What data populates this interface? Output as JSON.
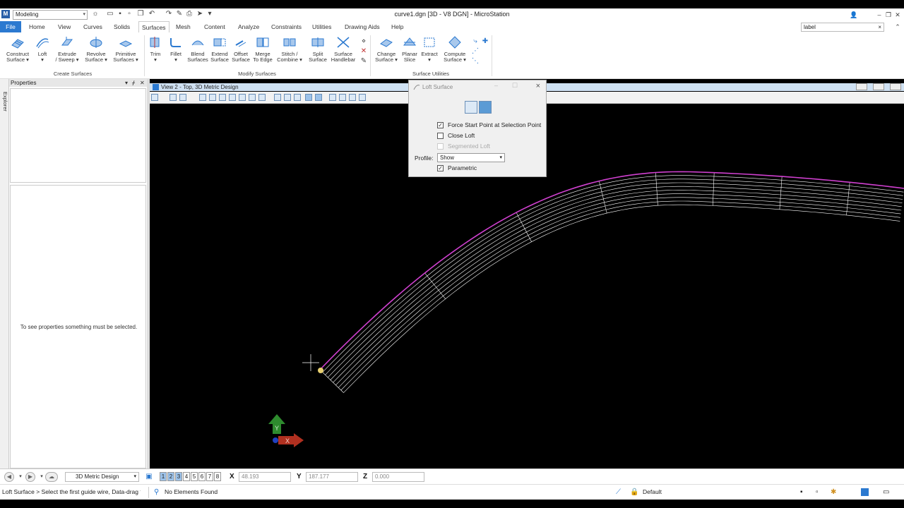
{
  "titlebar": {
    "workflow": "Modeling",
    "title": "curve1.dgn [3D - V8 DGN] - MicroStation",
    "search_value": "label",
    "search_clear": "×"
  },
  "tabs": [
    "File",
    "Home",
    "View",
    "Curves",
    "Solids",
    "Surfaces",
    "Mesh",
    "Content",
    "Analyze",
    "Constraints",
    "Utilities",
    "Drawing Aids",
    "Help"
  ],
  "ribbon": {
    "create": {
      "label": "Create Surfaces",
      "buttons": [
        {
          "l1": "Construct",
          "l2": "Surface ▾"
        },
        {
          "l1": "Loft",
          "l2": "▾"
        },
        {
          "l1": "Extrude",
          "l2": "/ Sweep ▾"
        },
        {
          "l1": "Revolve",
          "l2": "Surface ▾"
        },
        {
          "l1": "Primitive",
          "l2": "Surfaces ▾"
        }
      ]
    },
    "modify": {
      "label": "Modify Surfaces",
      "buttons": [
        {
          "l1": "Trim",
          "l2": "▾"
        },
        {
          "l1": "Fillet",
          "l2": "▾"
        },
        {
          "l1": "Blend",
          "l2": "Surfaces"
        },
        {
          "l1": "Extend",
          "l2": "Surface"
        },
        {
          "l1": "Offset",
          "l2": "Surface"
        },
        {
          "l1": "Merge",
          "l2": "To Edge"
        },
        {
          "l1": "Stitch /",
          "l2": "Combine ▾"
        },
        {
          "l1": "Split",
          "l2": "Surface"
        },
        {
          "l1": "Surface",
          "l2": "Handlebar"
        }
      ]
    },
    "utilities": {
      "label": "Surface Utilities",
      "buttons": [
        {
          "l1": "Change",
          "l2": "Surface ▾"
        },
        {
          "l1": "Planar",
          "l2": "Slice"
        },
        {
          "l1": "Extract",
          "l2": "▾"
        },
        {
          "l1": "Compute",
          "l2": "Surface ▾"
        }
      ]
    }
  },
  "left": {
    "explorer_label": "Explorer",
    "properties_title": "Properties",
    "properties_message": "To see properties something must be selected."
  },
  "view": {
    "title": "View 2 - Top, 3D Metric Design"
  },
  "dialog": {
    "title": "Loft Surface",
    "close": "×",
    "force_start": {
      "label": "Force Start Point at Selection Point",
      "checked": true
    },
    "close_loft": {
      "label": "Close Loft",
      "checked": false
    },
    "segmented": {
      "label": "Segmented Loft",
      "checked": false
    },
    "profile_label": "Profile:",
    "profile_value": "Show",
    "parametric": {
      "label": "Parametric",
      "checked": true
    },
    "check_mark": "✓"
  },
  "coords": {
    "model": "3D Metric Design",
    "view_numbers": [
      "1",
      "2",
      "3",
      "4",
      "5",
      "6",
      "7",
      "8"
    ],
    "x_label": "X",
    "x_value": "48.193",
    "y_label": "Y",
    "y_value": "187.177",
    "z_label": "Z",
    "z_value": "0.000"
  },
  "status": {
    "prompt": "Loft Surface > Select the first guide wire, Data-drag f",
    "message": "No Elements Found",
    "level": "Default"
  },
  "colors": {
    "accent": "#2b79d0",
    "profile_curve": "#d040d0",
    "wire": "#ffffff",
    "axis_y": "#2e8b2e",
    "axis_x": "#b03020"
  }
}
